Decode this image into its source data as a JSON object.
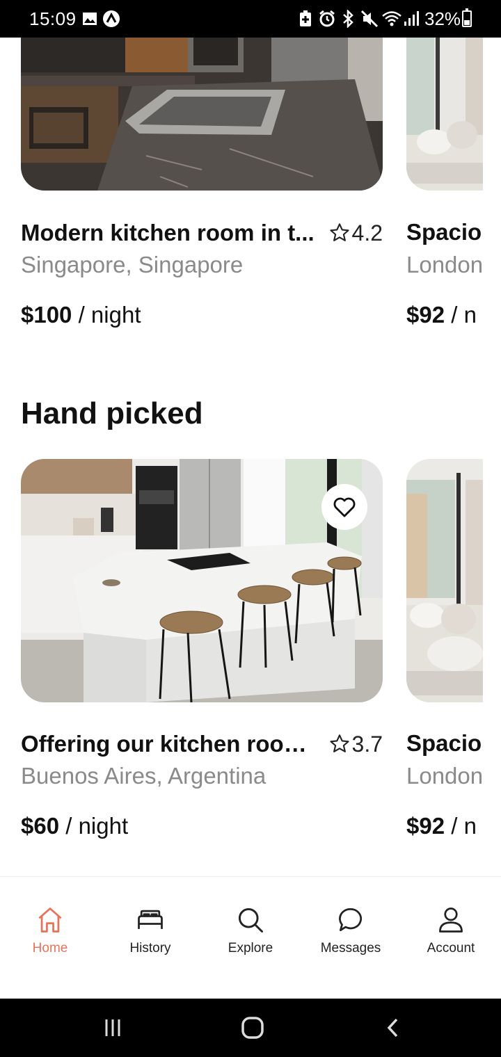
{
  "status_bar": {
    "time": "15:09",
    "battery_percent": "32%",
    "icons": [
      "gallery-icon",
      "app-notification-icon",
      "battery-saver-icon",
      "alarm-icon",
      "bluetooth-icon",
      "mute-icon",
      "wifi-icon",
      "signal-icon"
    ]
  },
  "top_row": {
    "card": {
      "title": "Modern kitchen room in t...",
      "rating": "4.2",
      "location": "Singapore, Singapore",
      "price": "$100",
      "price_unit": "/ night"
    },
    "peek_card": {
      "title": "Spacio",
      "location": "London",
      "price": "$92",
      "price_unit": "/ n"
    }
  },
  "hand_picked": {
    "title": "Hand picked",
    "card": {
      "title": "Offering our kitchen room...",
      "rating": "3.7",
      "location": "Buenos Aires, Argentina",
      "price": "$60",
      "price_unit": "/ night"
    },
    "peek_card": {
      "title": "Spacio",
      "location": "London",
      "price": "$92",
      "price_unit": "/ n"
    }
  },
  "bottom_nav": {
    "active": "Home",
    "items": [
      {
        "label": "Home",
        "icon": "home-icon"
      },
      {
        "label": "History",
        "icon": "bed-icon"
      },
      {
        "label": "Explore",
        "icon": "search-icon"
      },
      {
        "label": "Messages",
        "icon": "chat-icon"
      },
      {
        "label": "Account",
        "icon": "user-icon"
      }
    ]
  },
  "colors": {
    "accent": "#e8735a",
    "secondary_text": "#8a8a8a"
  }
}
